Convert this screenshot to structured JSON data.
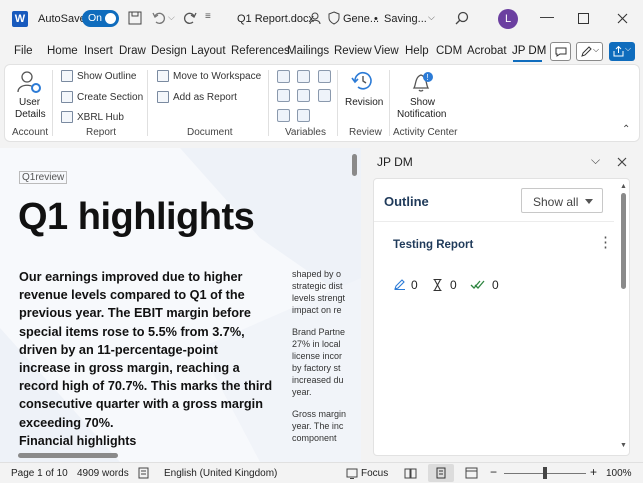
{
  "titlebar": {
    "app_icon": "word-icon",
    "autosave_label": "AutoSave",
    "autosave_state": "On",
    "doc_title": "Q1 Report.docx",
    "sensitivity": "Gene...",
    "save_status": "Saving...",
    "avatar_initial": "L"
  },
  "tabs": [
    "File",
    "Home",
    "Insert",
    "Draw",
    "Design",
    "Layout",
    "References",
    "Mailings",
    "Review",
    "View",
    "Help",
    "CDM",
    "Acrobat",
    "JP DM"
  ],
  "active_tab": "JP DM",
  "ribbon": {
    "user_details": {
      "line1": "User",
      "line2": "Details"
    },
    "report_buttons": [
      "Show Outline",
      "Create Section",
      "XBRL Hub"
    ],
    "document_buttons": [
      "Move to Workspace",
      "Add as Report"
    ],
    "revision_label": "Revision",
    "notification": {
      "line1": "Show",
      "line2": "Notification"
    },
    "groups": {
      "account": "Account",
      "report": "Report",
      "document": "Document",
      "variables": "Variables",
      "review": "Review",
      "activity": "Activity Center"
    }
  },
  "document": {
    "logo": "Q1review",
    "heading": "Q1 highlights",
    "intro_lines": [
      "Our earnings improved due to higher",
      "revenue levels compared to Q1 of the",
      "previous year. The EBIT margin before",
      "special items rose to 5.5% from 3.7%,",
      "driven by an 11-percentage-point",
      "increase in gross margin, reaching a",
      "record high of 70.7%. This marks the third",
      "consecutive quarter with a gross margin",
      "exceeding 70%."
    ],
    "subheading": "Financial highlights",
    "right_col_p1": [
      "shaped by o",
      "strategic dist",
      "levels strengt",
      "impact on re"
    ],
    "right_col_p2": [
      "Brand Partne",
      "27% in local",
      "license incor",
      "by factory st",
      "increased du",
      "year."
    ],
    "right_col_p3": [
      "Gross margin",
      "year. The inc",
      "component"
    ]
  },
  "pane": {
    "title": "JP DM",
    "outline_label": "Outline",
    "filter_value": "Show all",
    "report_name": "Testing Report",
    "counts": {
      "edits": "0",
      "pending": "0",
      "approved": "0"
    }
  },
  "status": {
    "page": "Page 1 of 10",
    "words": "4909 words",
    "language": "English (United Kingdom)",
    "focus": "Focus",
    "zoom": "100%",
    "zoom_level": 0.5
  },
  "colors": {
    "accent": "#0f6cbd",
    "word_blue": "#185abd",
    "green": "#2e8540"
  }
}
